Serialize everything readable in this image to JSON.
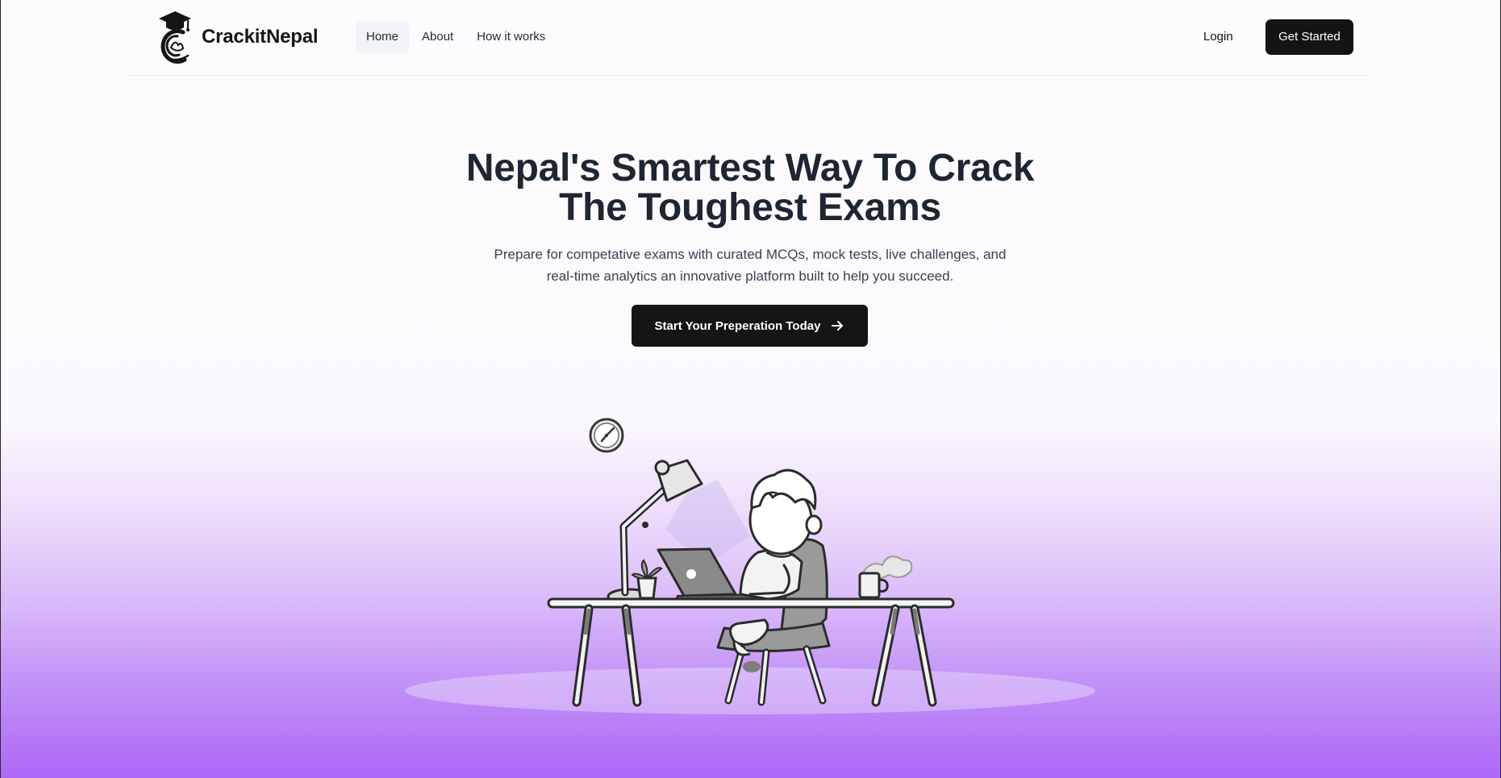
{
  "brand": {
    "name": "CrackitNepal",
    "logo_icon": "graduation-cap-c-logo"
  },
  "nav": {
    "links": [
      {
        "label": "Home",
        "active": true
      },
      {
        "label": "About",
        "active": false
      },
      {
        "label": "How it works",
        "active": false
      }
    ],
    "login_label": "Login",
    "get_started_label": "Get Started"
  },
  "hero": {
    "title_line1": "Nepal's Smartest Way To Crack",
    "title_line2": "The Toughest Exams",
    "subtitle_line1": "Prepare for competative exams with curated MCQs, mock tests, live challenges, and",
    "subtitle_line2": "real-time analytics an innovative platform built to help you succeed.",
    "cta_label": "Start Your Preperation Today",
    "cta_icon": "arrow-right-icon"
  },
  "illustration": {
    "description_icon": "student-studying-at-desk-illustration"
  },
  "colors": {
    "primary_dark": "#141414",
    "accent_purple": "#ad68f6",
    "heading": "#1e2533"
  }
}
